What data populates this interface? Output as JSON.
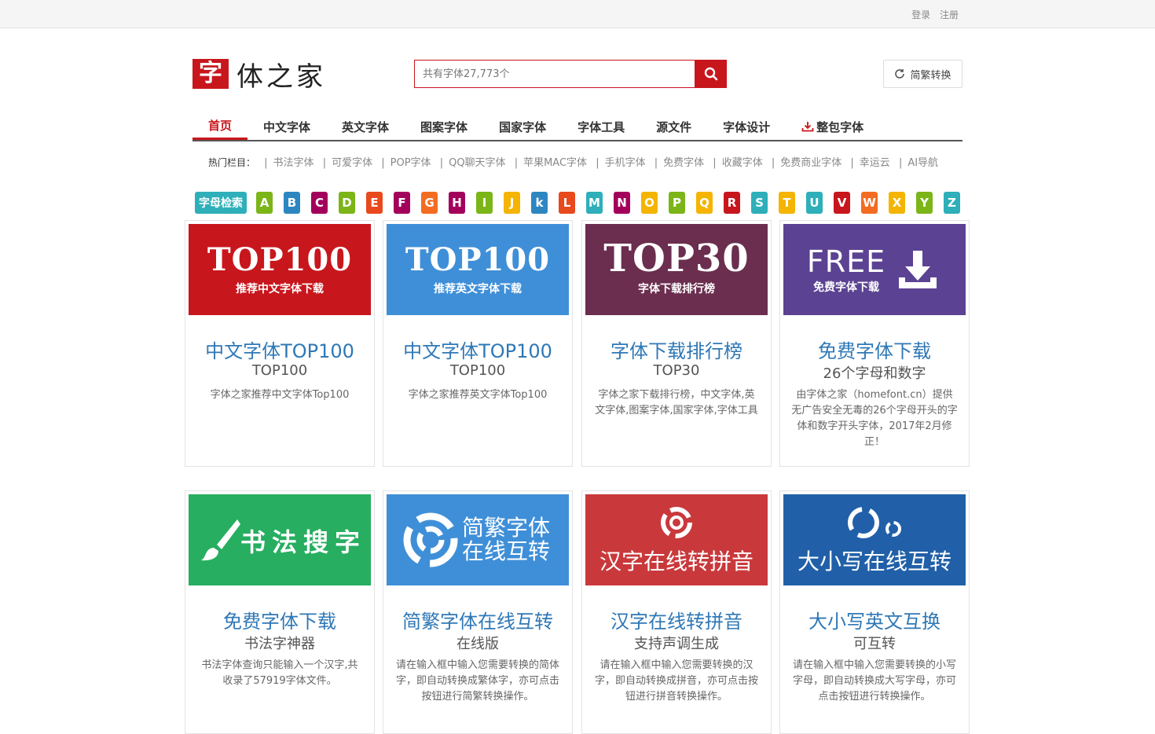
{
  "topbar": {
    "login": "登录",
    "register": "注册"
  },
  "logo": {
    "mark": "字",
    "text": "体之家"
  },
  "search": {
    "placeholder": "共有字体27,773个"
  },
  "convert_button": "简繁转换",
  "nav": [
    "首页",
    "中文字体",
    "英文字体",
    "图案字体",
    "国家字体",
    "字体工具",
    "源文件",
    "字体设计",
    "整包字体"
  ],
  "hot": {
    "label": "热门栏目：",
    "links": [
      "书法字体",
      "可爱字体",
      "POP字体",
      "QQ聊天字体",
      "苹果MAC字体",
      "手机字体",
      "免费字体",
      "收藏字体",
      "免费商业字体",
      "幸运云",
      "AI导航"
    ]
  },
  "alpha": {
    "lead": "字母检索",
    "letters": [
      "A",
      "B",
      "C",
      "D",
      "E",
      "F",
      "G",
      "H",
      "I",
      "J",
      "k",
      "L",
      "M",
      "N",
      "O",
      "P",
      "Q",
      "R",
      "S",
      "T",
      "U",
      "V",
      "W",
      "X",
      "Y",
      "Z"
    ],
    "colors": [
      "#7cb518",
      "#2e86c1",
      "#a3005c",
      "#7cb518",
      "#e8491d",
      "#a3005c",
      "#f36c21",
      "#a3005c",
      "#7cb518",
      "#f4b400",
      "#2e86c1",
      "#e8491d",
      "#2eafb9",
      "#a3005c",
      "#f4b400",
      "#7cb518",
      "#f4b400",
      "#c8161d",
      "#2eafb9",
      "#f4b400",
      "#2eafb9",
      "#c8161d",
      "#f36c21",
      "#f4b400",
      "#7cb518",
      "#2eafb9"
    ]
  },
  "cards_row1": [
    {
      "img_big": "TOP100",
      "img_sub": "推荐中文字体下载",
      "bg": "#c8161d",
      "title": "中文字体TOP100",
      "subtitle": "TOP100",
      "desc": "字体之家推荐中文字体Top100"
    },
    {
      "img_big": "TOP100",
      "img_sub": "推荐英文字体下载",
      "bg": "#3f8fd8",
      "title": "中文字体TOP100",
      "subtitle": "TOP100",
      "desc": "字体之家推荐英文字体Top100"
    },
    {
      "img_big": "TOP30",
      "img_sub": "字体下载排行榜",
      "bg": "#6b2e4f",
      "title": "字体下载排行榜",
      "subtitle": "TOP30",
      "desc": "字体之家下载排行榜，中文字体,英文字体,图案字体,国家字体,字体工具"
    },
    {
      "img_big": "FREE",
      "img_sub": "免费字体下载",
      "bg": "#5b4292",
      "title": "免费字体下载",
      "subtitle": "26个字母和数字",
      "desc": "由字体之家（homefont.cn）提供无广告安全无毒的26个字母开头的字体和数字开头字体，2017年2月修正！"
    }
  ],
  "cards_row2": [
    {
      "img_text": "书法搜字",
      "bg": "#27ae60",
      "title": "免费字体下载",
      "subtitle": "书法字神器",
      "desc": "书法字体查询只能输入一个汉字,共收录了57919字体文件。"
    },
    {
      "img_text": "简繁字体",
      "img_text2": "在线互转",
      "bg": "#3f8fd8",
      "title": "简繁字体在线互转",
      "subtitle": "在线版",
      "desc": "请在输入框中输入您需要转换的简体字，即自动转换成繁体字，亦可点击按钮进行简繁转换操作。"
    },
    {
      "img_text": "汉字在线转拼音",
      "bg": "#c9393c",
      "title": "汉字在线转拼音",
      "subtitle": "支持声调生成",
      "desc": "请在输入框中输入您需要转换的汉字，即自动转换成拼音，亦可点击按钮进行拼音转换操作。"
    },
    {
      "img_text": "大小写在线互转",
      "bg": "#2160a8",
      "title": "大小写英文互换",
      "subtitle": "可互转",
      "desc": "请在输入框中输入您需要转换的小写字母，即自动转换成大写字母，亦可点击按钮进行转换操作。"
    }
  ]
}
